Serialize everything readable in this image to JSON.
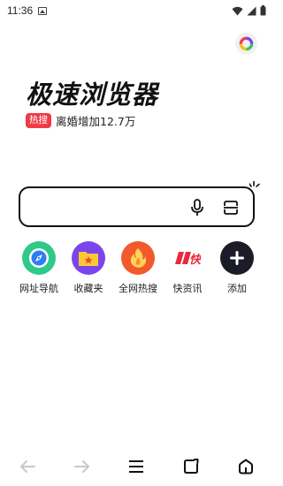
{
  "status_bar": {
    "time": "11:36",
    "notification_icon": "image-icon",
    "signal_icons": [
      "wifi-icon",
      "cell-signal-icon",
      "battery-icon"
    ]
  },
  "header": {
    "profile_icon": "colorful-ring-icon"
  },
  "brand": {
    "title": "极速浏览器"
  },
  "hot_search": {
    "badge": "热搜",
    "text": "离婚增加12.7万"
  },
  "search": {
    "placeholder": "",
    "voice_icon": "microphone-icon",
    "scan_icon": "scan-icon"
  },
  "shortcuts": [
    {
      "label": "网址导航",
      "icon": "compass-icon",
      "color": "#2fc98a"
    },
    {
      "label": "收藏夹",
      "icon": "star-folder-icon",
      "color": "#7b45ee"
    },
    {
      "label": "全网热搜",
      "icon": "flame-icon",
      "color": "#f25a2b"
    },
    {
      "label": "快资讯",
      "icon": "kuai-news-icon",
      "color": "#e8293b"
    },
    {
      "label": "添加",
      "icon": "plus-icon",
      "color": "#1c1c28"
    }
  ],
  "bottom_nav": [
    {
      "name": "back",
      "icon": "arrow-left-icon"
    },
    {
      "name": "forward",
      "icon": "arrow-right-icon"
    },
    {
      "name": "menu",
      "icon": "menu-icon"
    },
    {
      "name": "tabs",
      "icon": "tabs-icon"
    },
    {
      "name": "home",
      "icon": "home-icon"
    }
  ]
}
